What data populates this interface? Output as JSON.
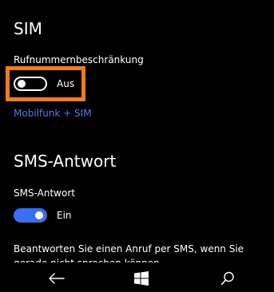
{
  "sim": {
    "title": "SIM",
    "restriction_label": "Rufnummernbeschränkung",
    "restriction_state": "Aus",
    "restriction_on": false,
    "link_label": "Mobilfunk + SIM"
  },
  "sms": {
    "title": "SMS-Antwort",
    "reply_label": "SMS-Antwort",
    "reply_state": "Ein",
    "reply_on": true,
    "description": "Beantworten Sie einen Anruf per SMS, wenn Sie gerade nicht sprechen können."
  },
  "navbar": {
    "back_icon": "back-arrow-icon",
    "start_icon": "windows-start-icon",
    "search_icon": "search-icon"
  },
  "colors": {
    "accent": "#3a6df0",
    "link": "#4d7cf4",
    "highlight": "#f07c1e",
    "background": "#000000"
  }
}
